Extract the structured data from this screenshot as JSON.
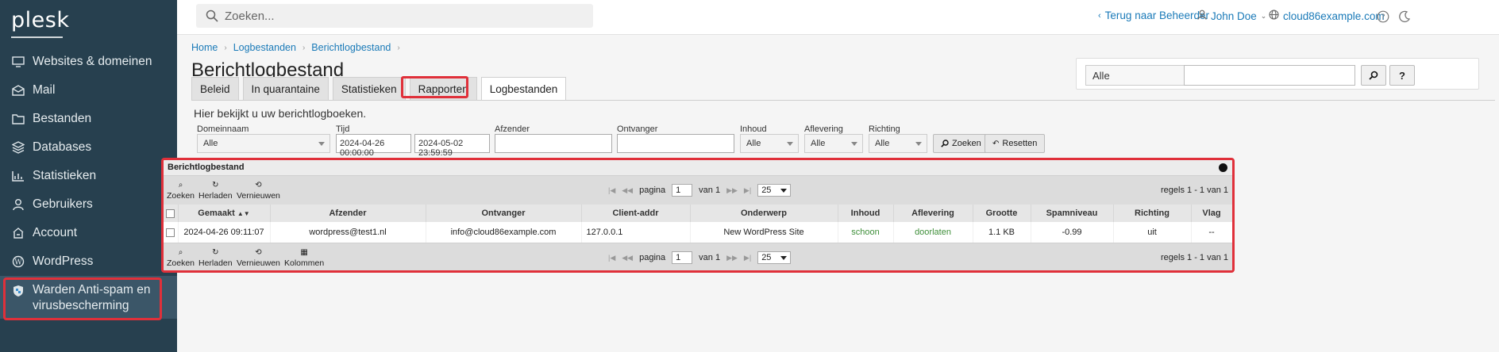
{
  "brand": "plesk",
  "sidebar": {
    "items": [
      {
        "label": "Websites & domeinen",
        "icon": "monitor-icon"
      },
      {
        "label": "Mail",
        "icon": "mail-icon"
      },
      {
        "label": "Bestanden",
        "icon": "folder-icon"
      },
      {
        "label": "Databases",
        "icon": "database-icon"
      },
      {
        "label": "Statistieken",
        "icon": "bar-chart-icon"
      },
      {
        "label": "Gebruikers",
        "icon": "user-icon"
      },
      {
        "label": "Account",
        "icon": "account-icon"
      },
      {
        "label": "WordPress",
        "icon": "wordpress-icon"
      },
      {
        "label": "Warden Anti-spam en virusbescherming",
        "icon": "shield-icon",
        "active": true
      }
    ]
  },
  "header": {
    "search_placeholder": "Zoeken...",
    "back_link": "Terug naar Beheerder",
    "user": "John Doe",
    "domain": "cloud86example.com"
  },
  "breadcrumb": [
    "Home",
    "Logbestanden",
    "Berichtlogbestand"
  ],
  "page_title": "Berichtlogbestand",
  "right_filter": {
    "select": "Alle",
    "search_btn": "⌕",
    "help_btn": "?"
  },
  "tabs": [
    {
      "label": "Beleid"
    },
    {
      "label": "In quarantaine"
    },
    {
      "label": "Statistieken"
    },
    {
      "label": "Rapporten"
    },
    {
      "label": "Logbestanden",
      "active": true
    }
  ],
  "info_text": "Hier bekijkt u uw berichtlogboeken.",
  "filters": {
    "domain_label": "Domeinnaam",
    "domain_value": "Alle",
    "time_label": "Tijd",
    "time_from": "2024-04-26 00:00:00",
    "time_to": "2024-05-02 23:59:59",
    "sender_label": "Afzender",
    "sender_value": "",
    "recipient_label": "Ontvanger",
    "recipient_value": "",
    "content_label": "Inhoud",
    "content_value": "Alle",
    "delivery_label": "Aflevering",
    "delivery_value": "Alle",
    "direction_label": "Richting",
    "direction_value": "Alle",
    "search_btn": "Zoeken",
    "reset_btn": "Resetten"
  },
  "panel": {
    "title": "Berichtlogbestand",
    "toolbar_top": [
      "Zoeken",
      "Herladen",
      "Vernieuwen"
    ],
    "toolbar_bottom": [
      "Zoeken",
      "Herladen",
      "Vernieuwen",
      "Kolommen"
    ],
    "pager": {
      "page_label": "pagina",
      "page": "1",
      "of_label": "van 1",
      "per_page": "25"
    },
    "rows_info": "regels 1 - 1 van 1",
    "columns": [
      "",
      "Gemaakt",
      "Afzender",
      "Ontvanger",
      "Client-addr",
      "Onderwerp",
      "Inhoud",
      "Aflevering",
      "Grootte",
      "Spamniveau",
      "Richting",
      "Vlag"
    ],
    "rows": [
      {
        "created": "2024-04-26 09:11:07",
        "sender": "wordpress@test1.nl",
        "recipient": "info@cloud86example.com",
        "client_addr": "127.0.0.1",
        "subject": "New WordPress Site",
        "content": "schoon",
        "delivery": "doorlaten",
        "size": "1.1 KB",
        "spam_level": "-0.99",
        "direction": "uit",
        "flag": "--"
      }
    ]
  },
  "colors": {
    "sidebar": "#27404f",
    "link": "#1a7ab8",
    "highlight": "#e0303a",
    "green": "#3f8f3a"
  }
}
